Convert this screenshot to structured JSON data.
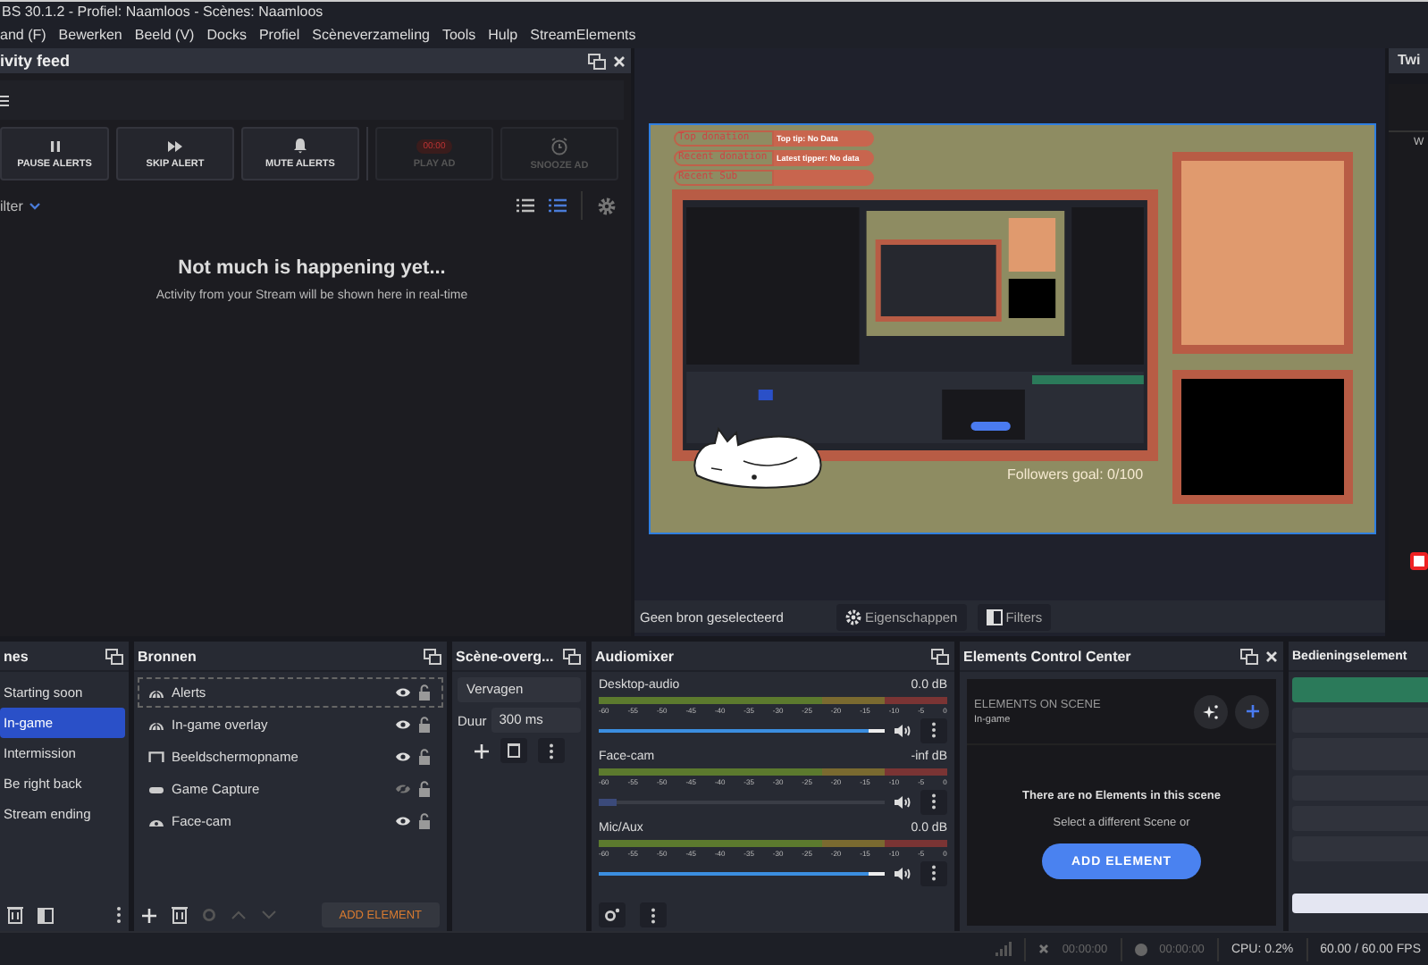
{
  "window": {
    "title": "BS 30.1.2 - Profiel: Naamloos - Scènes: Naamloos"
  },
  "menu": [
    "and (F)",
    "Bewerken",
    "Beeld (V)",
    "Docks",
    "Profiel",
    "Scèneverzameling",
    "Tools",
    "Hulp",
    "StreamElements"
  ],
  "activity_feed": {
    "title": "ivity feed",
    "buttons": [
      {
        "label": "PAUSE ALERTS",
        "kind": "pause",
        "disabled": false
      },
      {
        "label": "SKIP ALERT",
        "kind": "skip",
        "disabled": false
      },
      {
        "label": "MUTE ALERTS",
        "kind": "mute",
        "disabled": false
      },
      {
        "label": "PLAY AD",
        "kind": "ad",
        "disabled": true,
        "badge": "00:00"
      },
      {
        "label": "SNOOZE AD",
        "kind": "snooze",
        "disabled": true
      }
    ],
    "filter": "ilter",
    "views": [
      {
        "selected": false
      },
      {
        "selected": true
      }
    ],
    "empty_title": "Not much is happening yet...",
    "empty_text": "Activity from your Stream will be shown here in real-time"
  },
  "preview": {
    "overlay": [
      {
        "label": "Top donation",
        "value": "Top tip: No Data"
      },
      {
        "label": "Recent donation",
        "value": "Latest tipper: No data"
      },
      {
        "label": "Recent Sub"
      }
    ],
    "goal": "Followers goal: 0/100",
    "status": "Geen bron geselecteerd",
    "buttons": [
      {
        "label": "Eigenschappen",
        "kind": "gear"
      },
      {
        "label": "Filters",
        "kind": "filter"
      }
    ]
  },
  "right_dock": {
    "title": "Twi",
    "text": "W"
  },
  "scenes": {
    "title": "nes",
    "items": [
      {
        "name": "Starting soon",
        "selected": false
      },
      {
        "name": "In-game",
        "selected": true
      },
      {
        "name": "Intermission",
        "selected": false
      },
      {
        "name": "Be right back",
        "selected": false
      },
      {
        "name": "Stream ending",
        "selected": false
      }
    ]
  },
  "sources": {
    "title": "Bronnen",
    "add_button": "ADD ELEMENT",
    "items": [
      {
        "name": "Alerts",
        "kind": "browser",
        "visible": true,
        "selected": true
      },
      {
        "name": "In-game overlay",
        "kind": "browser",
        "visible": true,
        "selected": false
      },
      {
        "name": "Beeldschermopname",
        "kind": "display",
        "visible": true,
        "selected": false
      },
      {
        "name": "Game Capture",
        "kind": "game",
        "visible": false,
        "selected": false
      },
      {
        "name": "Face-cam",
        "kind": "camera",
        "visible": true,
        "selected": false
      }
    ]
  },
  "transitions": {
    "title": "Scène-overg...",
    "select": "Vervagen",
    "duration_label": "Duur",
    "duration": "300 ms"
  },
  "audio": {
    "title": "Audiomixer",
    "channels": [
      {
        "name": "Desktop-audio",
        "reading": "0.0 dB",
        "level": 1.0,
        "ticks": [
          "-60",
          "-55",
          "-50",
          "-45",
          "-40",
          "-35",
          "-30",
          "-25",
          "-20",
          "-15",
          "-10",
          "-5",
          "0"
        ]
      },
      {
        "name": "Face-cam",
        "reading": "-inf dB",
        "level": 0.06,
        "ticks": [
          "-60",
          "-55",
          "-50",
          "-45",
          "-40",
          "-35",
          "-30",
          "-25",
          "-20",
          "-15",
          "-10",
          "-5",
          "0"
        ]
      },
      {
        "name": "Mic/Aux",
        "reading": "0.0 dB",
        "level": 1.0,
        "ticks": [
          "-60",
          "-55",
          "-50",
          "-45",
          "-40",
          "-35",
          "-30",
          "-25",
          "-20",
          "-15",
          "-10",
          "-5",
          "0"
        ]
      }
    ]
  },
  "elements": {
    "title": "Elements Control Center",
    "heading": "ELEMENTS ON SCENE",
    "scene": "In-game",
    "empty_title": "There are no Elements in this scene",
    "empty_text": "Select a different Scene or",
    "button": "ADD ELEMENT"
  },
  "controls": {
    "title": "Bedieningselement",
    "buttons": [
      {
        "kind": "primary"
      },
      {
        "kind": "plain"
      },
      {
        "kind": "tall"
      },
      {
        "kind": "plain"
      },
      {
        "kind": "plain"
      },
      {
        "kind": "plain"
      },
      {
        "kind": "light"
      }
    ]
  },
  "status_bar": {
    "stream_time": "00:00:00",
    "record_time": "00:00:00",
    "cpu": "CPU: 0.2%",
    "fps": "60.00 / 60.00 FPS"
  }
}
